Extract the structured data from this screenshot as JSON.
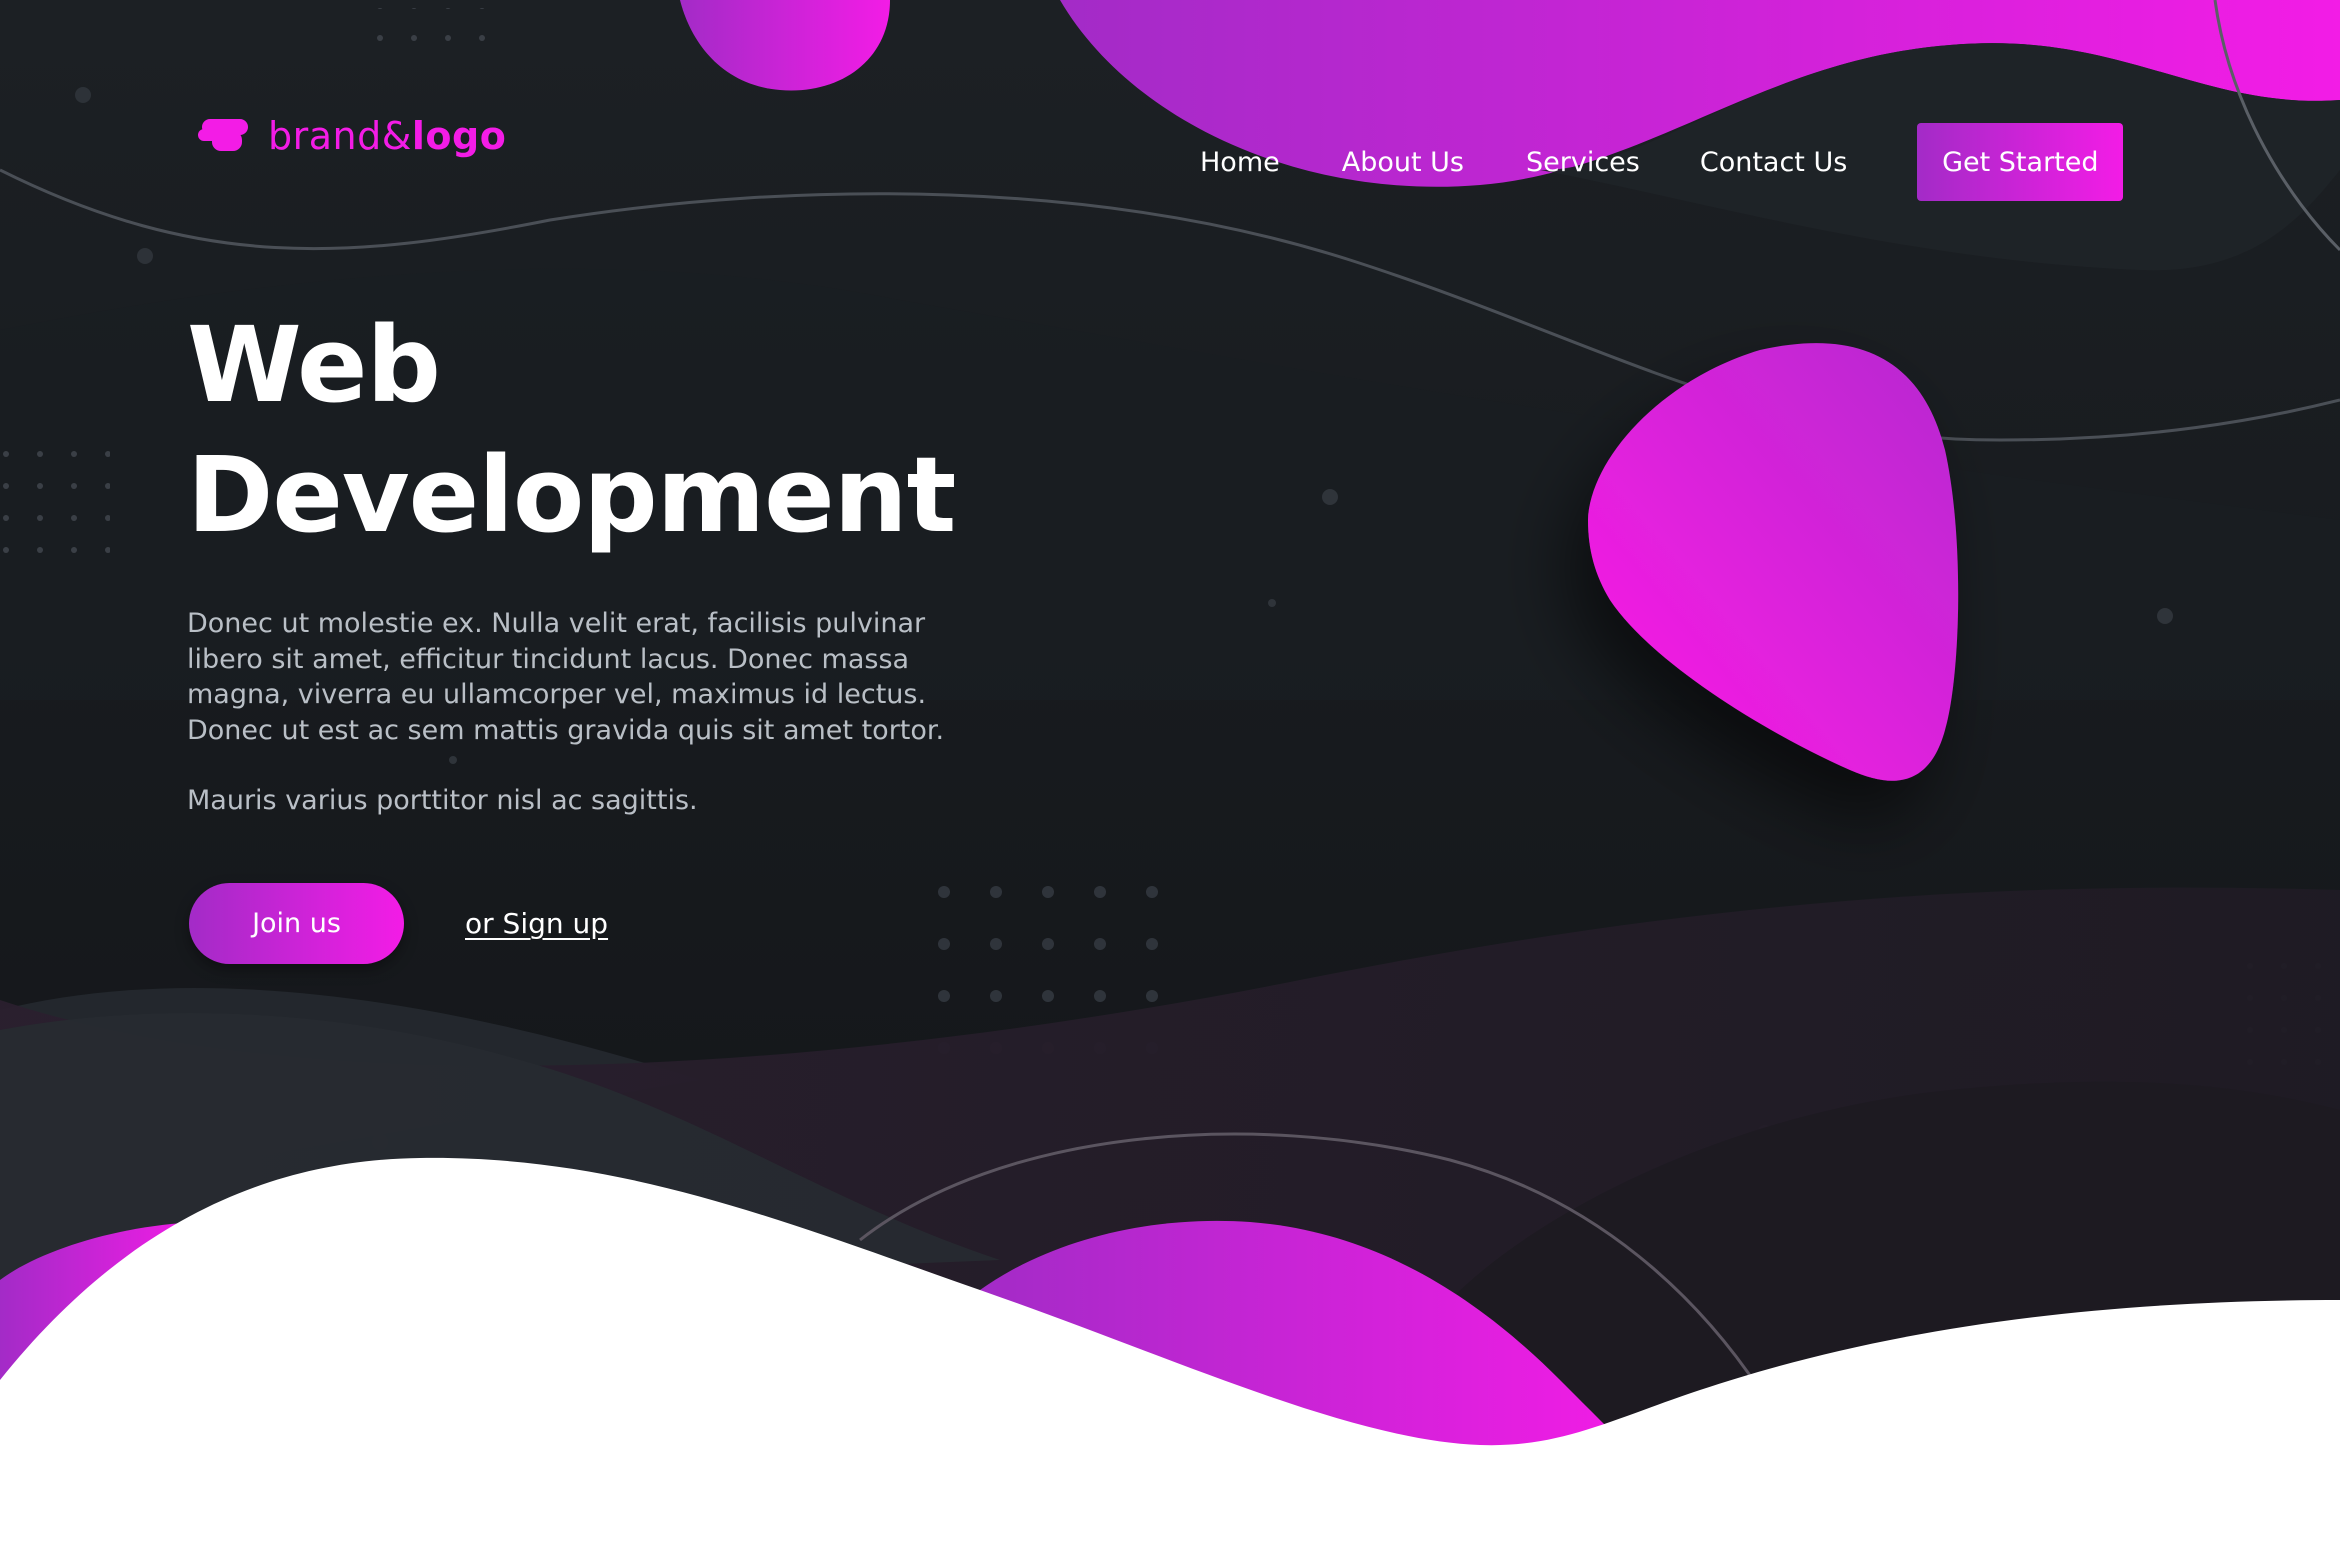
{
  "brand": {
    "logo_regular": "brand&",
    "logo_bold": "logo",
    "logo_icon": "brand-mark-icon"
  },
  "nav": {
    "items": [
      {
        "label": "Home"
      },
      {
        "label": "About Us"
      },
      {
        "label": "Services"
      },
      {
        "label": "Contact Us"
      }
    ],
    "cta_label": "Get Started"
  },
  "hero": {
    "title_line1": "Web",
    "title_line2": "Development",
    "body": "Donec ut molestie ex. Nulla velit erat, facilisis pulvinar libero sit amet, efficitur tincidunt lacus. Donec massa magna, viverra eu ullamcorper vel, maximus id lectus. Donec ut est ac sem mattis gravida quis sit amet tortor.",
    "sub": "Mauris varius porttitor nisl ac sagittis.",
    "primary_button": "Join us",
    "secondary_link": "or Sign up"
  },
  "colors": {
    "background": "#15181c",
    "accent_magenta": "#f31ce6",
    "accent_purple": "#a32bc7",
    "text_light": "#ffffff",
    "text_muted": "#b9bfc6"
  }
}
